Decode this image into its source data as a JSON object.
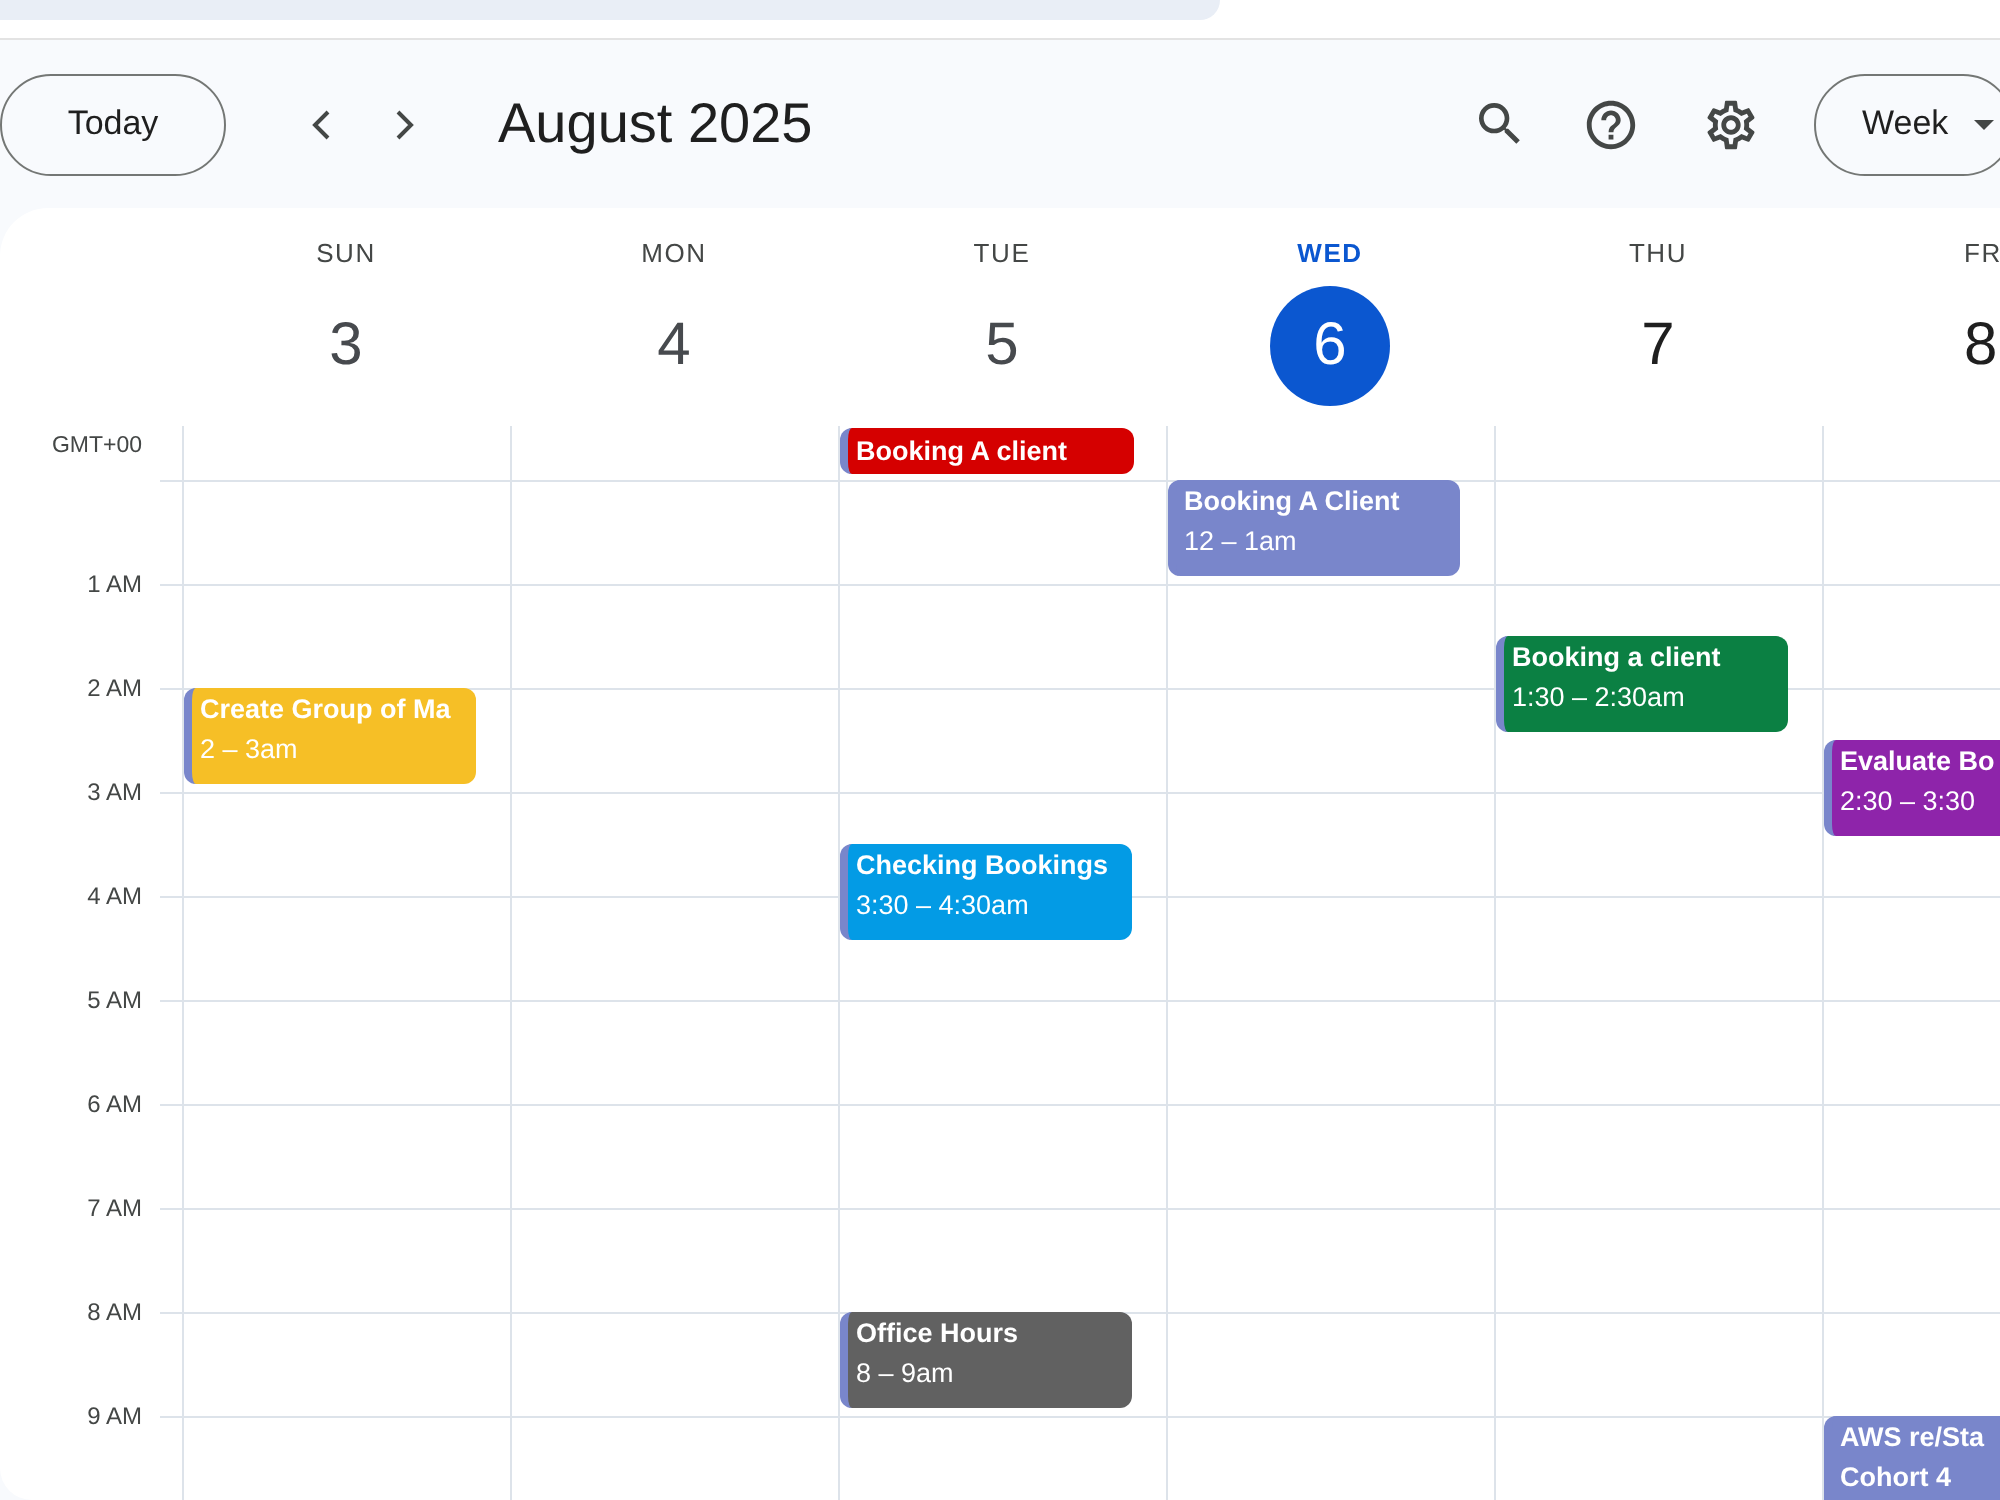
{
  "toolbar": {
    "today_button": "Today",
    "title": "August 2025",
    "view_button": "Week"
  },
  "days": [
    {
      "weekday": "SUN",
      "date": "3",
      "today": false,
      "past": true,
      "events": [
        {
          "title": [
            "Create Group of Ma"
          ],
          "time": "2 – 3am",
          "color": "#f6bf26"
        }
      ]
    },
    {
      "weekday": "MON",
      "date": "4",
      "today": false,
      "past": true
    },
    {
      "weekday": "TUE",
      "date": "5",
      "today": false,
      "past": true,
      "all_day": [
        {
          "title": "Booking A client",
          "color": "#d50000"
        }
      ],
      "events": [
        {
          "title": [
            "Checking Bookings"
          ],
          "time": "3:30 – 4:30am",
          "color": "#039be5"
        },
        {
          "title": [
            "Office Hours"
          ],
          "time": "8 – 9am",
          "color": "#616161"
        }
      ]
    },
    {
      "weekday": "WED",
      "date": "6",
      "today": true,
      "events": [
        {
          "title": [
            "Booking A Client"
          ],
          "time": "12 – 1am",
          "color": "#7986cb"
        }
      ]
    },
    {
      "weekday": "THU",
      "date": "7",
      "today": false,
      "past": false,
      "events": [
        {
          "title": [
            "Booking a client"
          ],
          "time": "1:30 – 2:30am",
          "color": "#0b8043"
        }
      ]
    },
    {
      "weekday": "FR",
      "date": "8",
      "today": false,
      "past": false,
      "events": [
        {
          "title": [
            "Evaluate Bo"
          ],
          "time": "2:30 – 3:30",
          "color": "#8e24aa"
        },
        {
          "title": [
            "AWS re/Sta",
            "Cohort 4"
          ],
          "color": "#7986cb"
        }
      ]
    }
  ],
  "time_grid": {
    "time_zone": "GMT+00",
    "hours": [
      "1 AM",
      "2 AM",
      "3 AM",
      "4 AM",
      "5 AM",
      "6 AM",
      "7 AM",
      "8 AM",
      "9 AM"
    ]
  }
}
